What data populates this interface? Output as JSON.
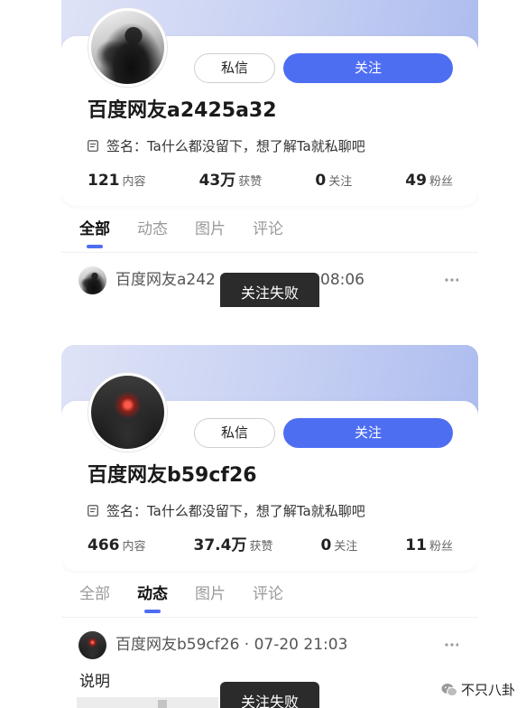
{
  "profiles": [
    {
      "name": "百度网友a2425a32",
      "signature": "签名：Ta什么都没留下，想了解Ta就私聊吧",
      "buttons": {
        "message": "私信",
        "follow": "关注"
      },
      "stats": [
        {
          "value": "121",
          "label": "内容"
        },
        {
          "value": "43万",
          "label": "获赞"
        },
        {
          "value": "0",
          "label": "关注"
        },
        {
          "value": "49",
          "label": "粉丝"
        }
      ],
      "tabs": [
        {
          "label": "全部",
          "active": true
        },
        {
          "label": "动态",
          "active": false
        },
        {
          "label": "图片",
          "active": false
        },
        {
          "label": "评论",
          "active": false
        }
      ],
      "post": {
        "author": "百度网友a242",
        "time": "08:06"
      },
      "toast": "关注失败"
    },
    {
      "name": "百度网友b59cf26",
      "signature": "签名：Ta什么都没留下，想了解Ta就私聊吧",
      "buttons": {
        "message": "私信",
        "follow": "关注"
      },
      "stats": [
        {
          "value": "466",
          "label": "内容"
        },
        {
          "value": "37.4万",
          "label": "获赞"
        },
        {
          "value": "0",
          "label": "关注"
        },
        {
          "value": "11",
          "label": "粉丝"
        }
      ],
      "tabs": [
        {
          "label": "全部",
          "active": false
        },
        {
          "label": "动态",
          "active": true
        },
        {
          "label": "图片",
          "active": false
        },
        {
          "label": "评论",
          "active": false
        }
      ],
      "post": {
        "meta": "百度网友b59cf26 · 07-20 21:03",
        "body": "说明"
      },
      "toast": "关注失败"
    }
  ],
  "watermark": {
    "text": "不只八卦"
  },
  "icons": {
    "signature": "document-icon",
    "more": "more-icon",
    "watermark": "wechat-icon"
  },
  "colors": {
    "accent": "#4e6ef2",
    "toast_bg": "#2b2b2b"
  }
}
